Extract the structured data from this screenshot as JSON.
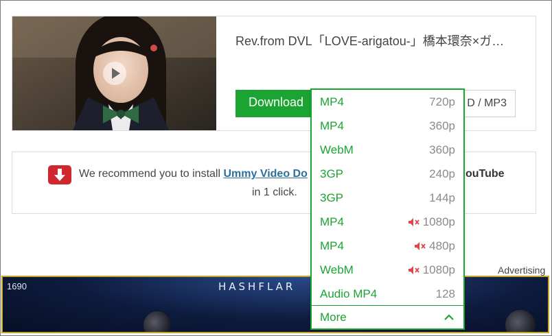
{
  "video": {
    "title": "Rev.from DVL「LOVE-arigatou-」橋本環奈×ガ…",
    "download_label": "Download",
    "mp3_label": "D / MP3"
  },
  "formats": [
    {
      "type": "MP4",
      "quality": "720p",
      "muted": false
    },
    {
      "type": "MP4",
      "quality": "360p",
      "muted": false
    },
    {
      "type": "WebM",
      "quality": "360p",
      "muted": false
    },
    {
      "type": "3GP",
      "quality": "240p",
      "muted": false
    },
    {
      "type": "3GP",
      "quality": "144p",
      "muted": false
    },
    {
      "type": "MP4",
      "quality": "1080p",
      "muted": true
    },
    {
      "type": "MP4",
      "quality": "480p",
      "muted": true
    },
    {
      "type": "WebM",
      "quality": "1080p",
      "muted": true
    },
    {
      "type": "Audio MP4",
      "quality": "128",
      "muted": false
    }
  ],
  "more_label": "More",
  "recommend": {
    "prefix": "We recommend you to install ",
    "link": "Ummy Video Do",
    "tail": "ouTube",
    "line2": "in 1 click."
  },
  "ad": {
    "label": "Advertising",
    "number": "1690",
    "brand": "HASHFLAR"
  },
  "colors": {
    "accent_green": "#1ca432",
    "mute_red": "#e0454b",
    "icon_red": "#d0262d",
    "link_blue": "#2d6f9b"
  },
  "icons": {
    "play": "play-icon",
    "recommend": "download-arrow-icon",
    "mute": "muted-speaker-icon",
    "more": "chevron-up-icon"
  }
}
